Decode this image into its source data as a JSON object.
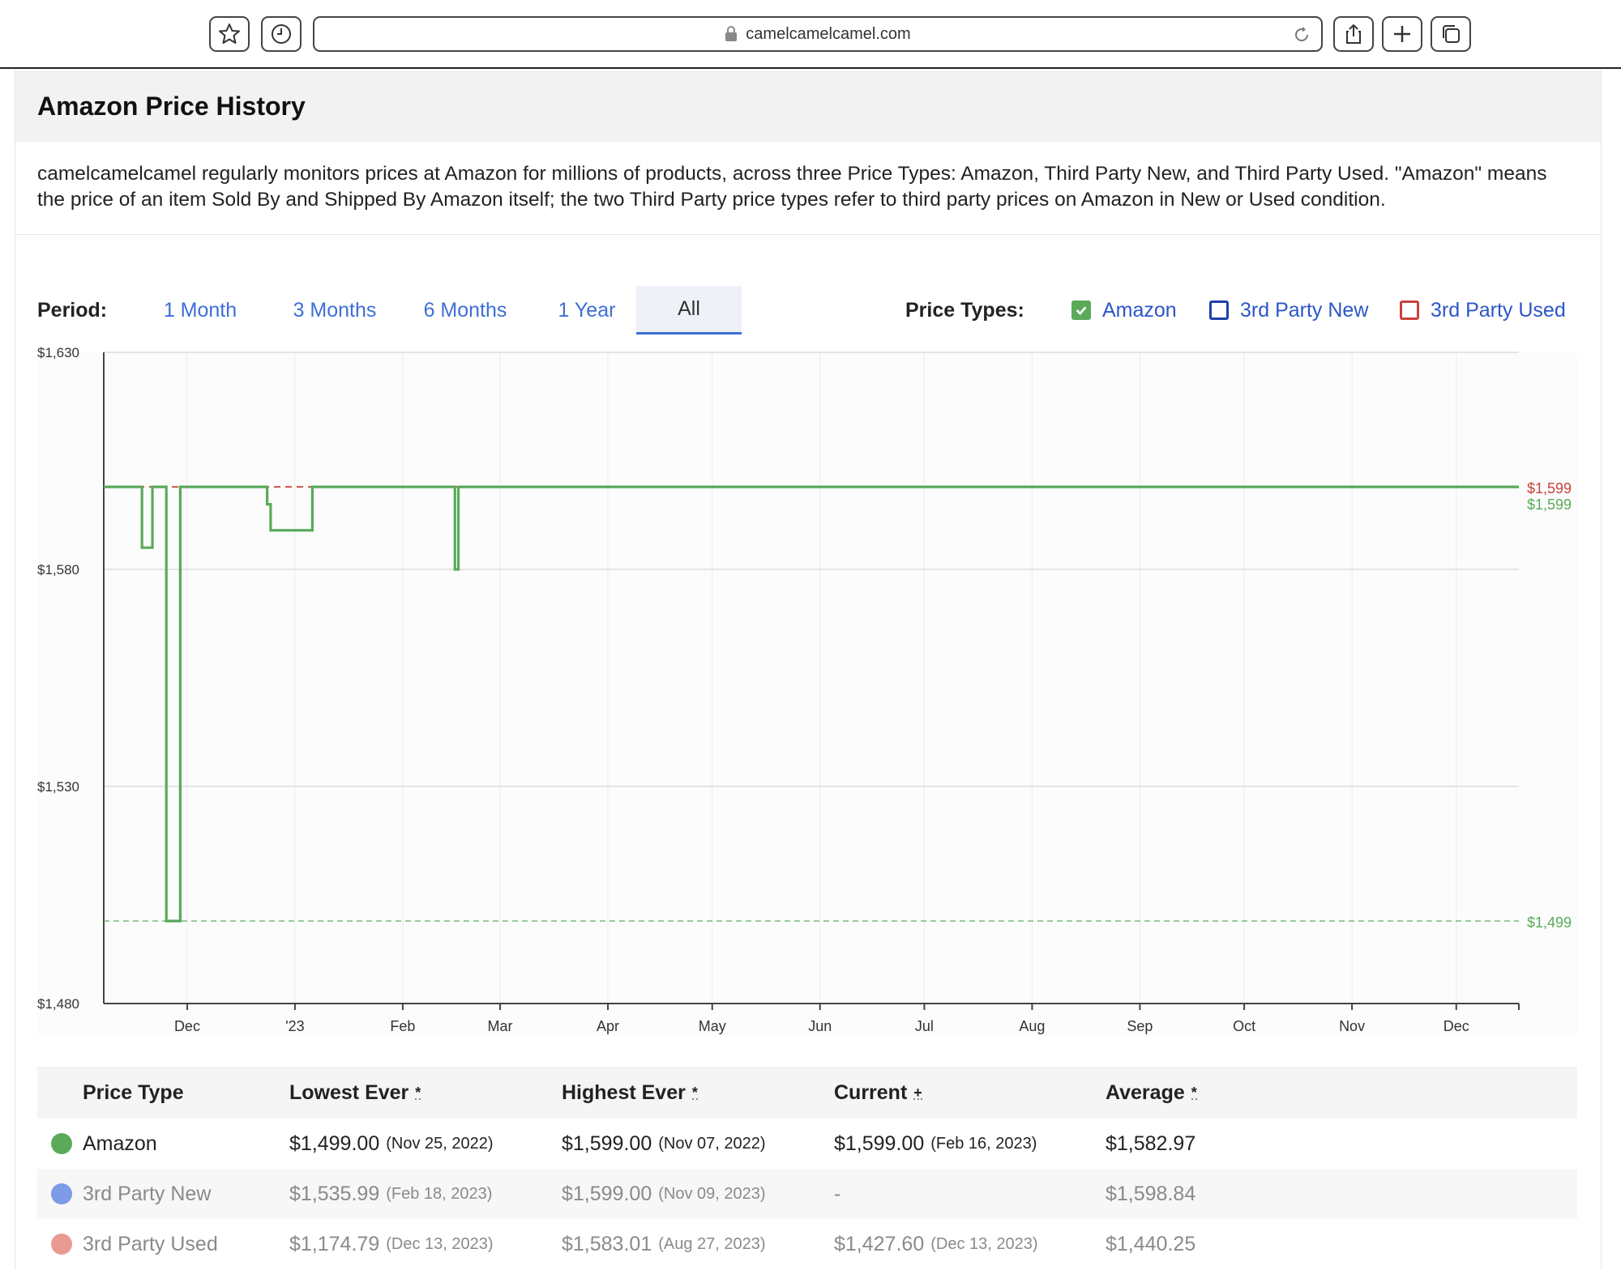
{
  "browser": {
    "url": "camelcamelcamel.com",
    "buttons": [
      "bookmark-icon",
      "history-icon",
      "share-icon",
      "new-tab-icon",
      "tabs-icon"
    ]
  },
  "header": {
    "title": "Amazon Price History"
  },
  "intro": {
    "text": "camelcamelcamel regularly monitors prices at Amazon for millions of products, across three Price Types: Amazon, Third Party New, and Third Party Used. \"Amazon\" means the price of an item Sold By and Shipped By Amazon itself; the two Third Party price types refer to third party prices on Amazon in New or Used condition."
  },
  "period": {
    "label": "Period:",
    "options": [
      "1 Month",
      "3 Months",
      "6 Months",
      "1 Year",
      "All"
    ],
    "selected": "All"
  },
  "price_types": {
    "label": "Price Types:",
    "options": [
      {
        "label": "Amazon",
        "checked": true,
        "color": "#5aaa5a"
      },
      {
        "label": "3rd Party New",
        "checked": false,
        "color": "#1f3fa8"
      },
      {
        "label": "3rd Party Used",
        "checked": false,
        "color": "#c8423b"
      }
    ]
  },
  "chart_data": {
    "type": "line",
    "y_ticks": [
      "$1,630",
      "$1,580",
      "$1,530",
      "$1,480"
    ],
    "ylim": [
      1480,
      1630
    ],
    "x_ticks": [
      "Dec",
      "'23",
      "Feb",
      "Mar",
      "Apr",
      "May",
      "Jun",
      "Jul",
      "Aug",
      "Sep",
      "Oct",
      "Nov",
      "Dec"
    ],
    "xlim": [
      "2022-11-07",
      "2023-12-19"
    ],
    "x_tick_dates": [
      "2022-12-01",
      "2023-01-01",
      "2023-02-01",
      "2023-03-01",
      "2023-04-01",
      "2023-05-01",
      "2023-06-01",
      "2023-07-01",
      "2023-08-01",
      "2023-09-01",
      "2023-10-01",
      "2023-11-01",
      "2023-12-01"
    ],
    "grid": true,
    "series": [
      {
        "name": "Amazon",
        "color": "#5aaa5a",
        "step": true,
        "points": [
          [
            "2022-11-07",
            1599
          ],
          [
            "2022-11-18",
            1585
          ],
          [
            "2022-11-21",
            1599
          ],
          [
            "2022-11-25",
            1499
          ],
          [
            "2022-11-29",
            1599
          ],
          [
            "2022-12-24",
            1595
          ],
          [
            "2022-12-25",
            1589
          ],
          [
            "2023-01-06",
            1599
          ],
          [
            "2023-02-16",
            1580
          ],
          [
            "2023-02-17",
            1599
          ],
          [
            "2023-12-19",
            1599
          ]
        ]
      },
      {
        "name": "3rd Party Used",
        "color": "#c8423b",
        "step": true,
        "dashed": true,
        "points": [
          [
            "2022-11-07",
            1599
          ],
          [
            "2023-12-19",
            1599
          ]
        ]
      }
    ],
    "reference_lines": [
      {
        "value": 1499,
        "color": "#5aaa5a",
        "dashed": true
      }
    ],
    "right_labels": [
      {
        "text": "$1,599",
        "value": 1599,
        "color": "#c8423b"
      },
      {
        "text": "$1,599",
        "value": 1599,
        "color": "#5aaa5a"
      },
      {
        "text": "$1,499",
        "value": 1499,
        "color": "#5aaa5a"
      }
    ]
  },
  "table": {
    "headers": [
      "Price Type",
      "Lowest Ever",
      "Highest Ever",
      "Current",
      "Average"
    ],
    "header_notes": [
      "",
      "*",
      "*",
      "+",
      "*"
    ],
    "rows": [
      {
        "type": "Amazon",
        "dot": "#5aaa5a",
        "lowest": "$1,499.00",
        "lowest_date": "(Nov 25, 2022)",
        "highest": "$1,599.00",
        "highest_date": "(Nov 07, 2022)",
        "current": "$1,599.00",
        "current_date": "(Feb 16, 2023)",
        "average": "$1,582.97"
      },
      {
        "type": "3rd Party New",
        "dot": "#7d9be6",
        "lowest": "$1,535.99",
        "lowest_date": "(Feb 18, 2023)",
        "highest": "$1,599.00",
        "highest_date": "(Nov 09, 2023)",
        "current": "-",
        "current_date": "",
        "average": "$1,598.84"
      },
      {
        "type": "3rd Party Used",
        "dot": "#e99b91",
        "lowest": "$1,174.79",
        "lowest_date": "(Dec 13, 2023)",
        "highest": "$1,583.01",
        "highest_date": "(Aug 27, 2023)",
        "current": "$1,427.60",
        "current_date": "(Dec 13, 2023)",
        "average": "$1,440.25"
      }
    ]
  }
}
